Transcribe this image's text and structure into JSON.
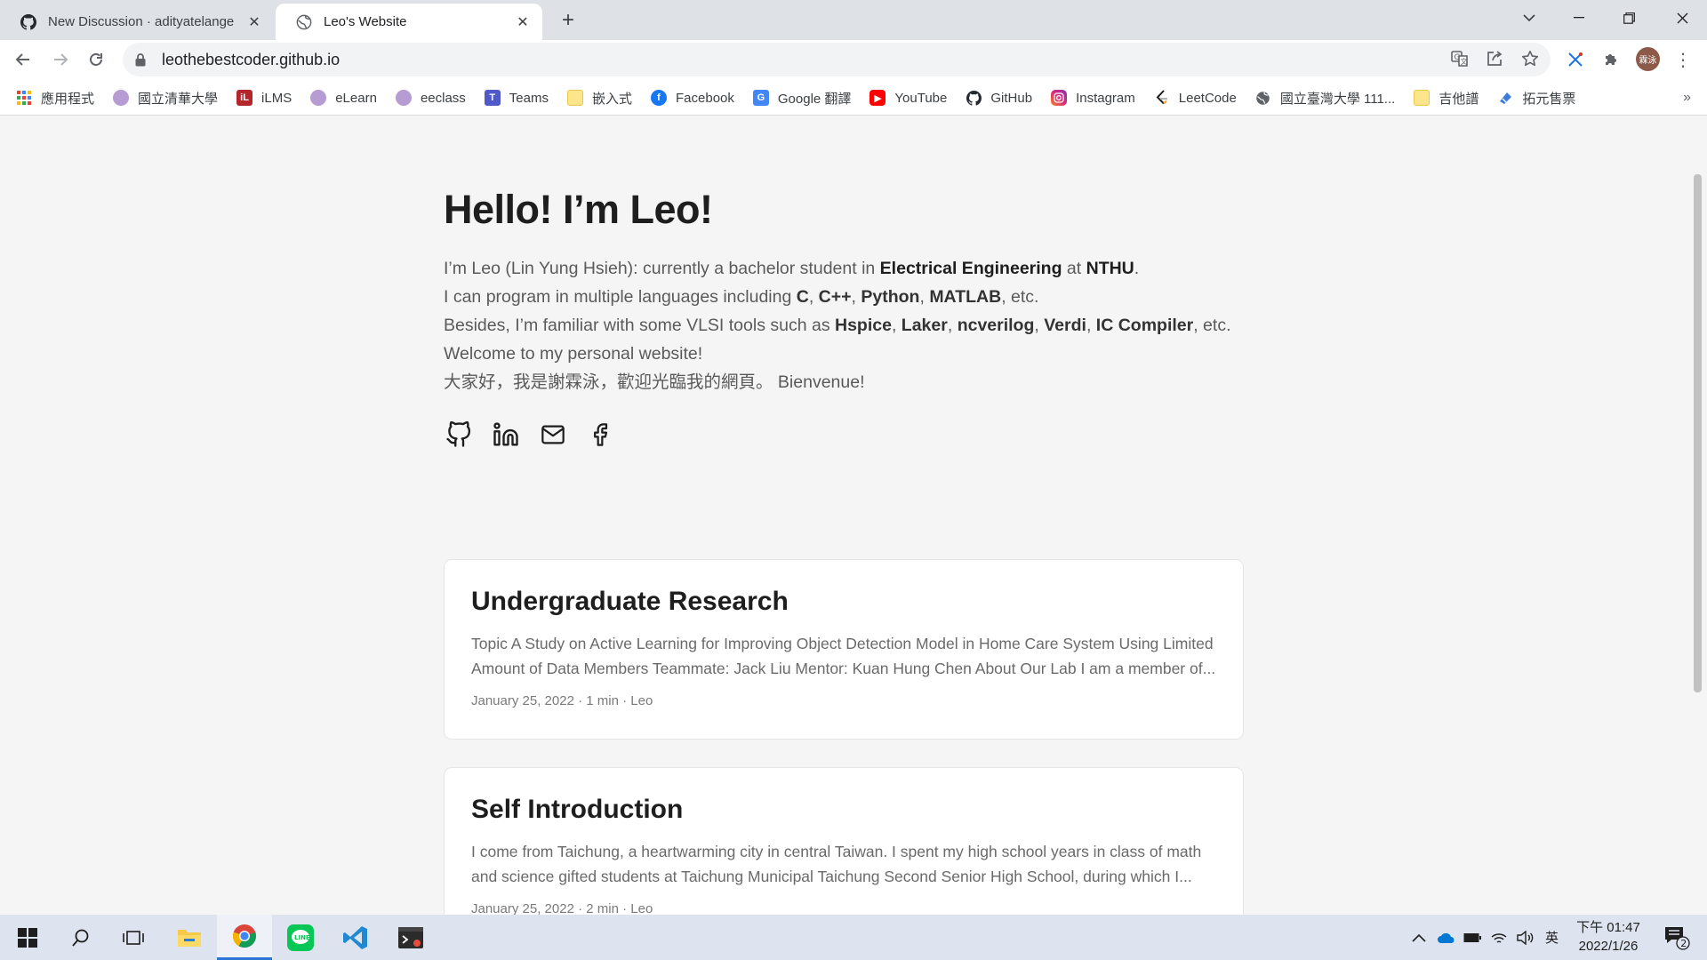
{
  "browser": {
    "tabs": [
      {
        "title": "New Discussion · adityatelange",
        "active": false
      },
      {
        "title": "Leo's Website",
        "active": true
      }
    ],
    "new_tab_symbol": "+",
    "url": "leothebestcoder.github.io",
    "avatar_text": "霖泳",
    "bookmarks": [
      {
        "label": "應用程式",
        "icon": "apps-grid-icon"
      },
      {
        "label": "國立清華大學",
        "icon": "nthu-icon"
      },
      {
        "label": "iLMS",
        "icon": "ilms-icon"
      },
      {
        "label": "eLearn",
        "icon": "elearn-icon"
      },
      {
        "label": "eeclass",
        "icon": "eeclass-icon"
      },
      {
        "label": "Teams",
        "icon": "teams-icon"
      },
      {
        "label": "嵌入式",
        "icon": "folder-icon"
      },
      {
        "label": "Facebook",
        "icon": "facebook-icon"
      },
      {
        "label": "Google 翻譯",
        "icon": "google-translate-icon"
      },
      {
        "label": "YouTube",
        "icon": "youtube-icon"
      },
      {
        "label": "GitHub",
        "icon": "github-icon"
      },
      {
        "label": "Instagram",
        "icon": "instagram-icon"
      },
      {
        "label": "LeetCode",
        "icon": "leetcode-icon"
      },
      {
        "label": "國立臺灣大學 111...",
        "icon": "globe-icon"
      },
      {
        "label": "吉他譜",
        "icon": "folder-icon"
      },
      {
        "label": "拓元售票",
        "icon": "tixcraft-icon"
      }
    ],
    "bookmarks_overflow": "»"
  },
  "page": {
    "heading": "Hello! I’m Leo!",
    "intro": {
      "l1_a": "I’m Leo (Lin Yung Hsieh): currently a bachelor student in ",
      "l1_b": "Electrical Engineering",
      "l1_c": " at ",
      "l1_d": "NTHU",
      "l1_e": ".",
      "l2_a": "I can program in multiple languages including ",
      "l2_c": "C",
      "l2_sep1": ", ",
      "l2_cpp": "C++",
      "l2_sep2": ", ",
      "l2_py": "Python",
      "l2_sep3": ", ",
      "l2_ml": "MATLAB",
      "l2_end": ", etc.",
      "l3_a": "Besides, I’m familiar with some VLSI tools such as ",
      "l3_t1": "Hspice",
      "l3_s1": ", ",
      "l3_t2": "Laker",
      "l3_s2": ", ",
      "l3_t3": "ncverilog",
      "l3_s3": ", ",
      "l3_t4": "Verdi",
      "l3_s4": ", ",
      "l3_t5": "IC Compiler",
      "l3_end": ", etc.",
      "l4": "Welcome to my personal website!",
      "l5": "大家好，我是謝霖泳，歡迎光臨我的網頁。 Bienvenue!"
    },
    "social": [
      "github-icon",
      "linkedin-icon",
      "email-icon",
      "facebook-icon"
    ],
    "posts": [
      {
        "title": "Undergraduate Research",
        "summary": "Topic A Study on Active Learning for Improving Object Detection Model in Home Care System Using Limited Amount of Data Members Teammate: Jack Liu Mentor: Kuan Hung Chen About Our Lab I am a member of...",
        "meta": "January 25, 2022 · 1 min · Leo"
      },
      {
        "title": "Self Introduction",
        "summary": "I come from Taichung, a heartwarming city in central Taiwan. I spent my high school years in class of math and science gifted students at Taichung Municipal Taichung Second Senior High School, during which I...",
        "meta": "January 25, 2022 · 2 min · Leo"
      }
    ]
  },
  "taskbar": {
    "apps": [
      "windows-start-icon",
      "search-icon",
      "task-view-icon",
      "file-explorer-icon",
      "chrome-icon",
      "line-icon",
      "vscode-icon",
      "terminal-app-icon"
    ],
    "ime": "英",
    "time": "下午 01:47",
    "date": "2022/1/26",
    "notification_count": "2"
  },
  "colors": {
    "page_bg": "#f5f5f5",
    "text_primary": "#1e1e1e",
    "text_secondary": "#5a5a5a",
    "chrome_tabstrip": "#dee1e6",
    "taskbar_bg": "#dde4ef"
  }
}
